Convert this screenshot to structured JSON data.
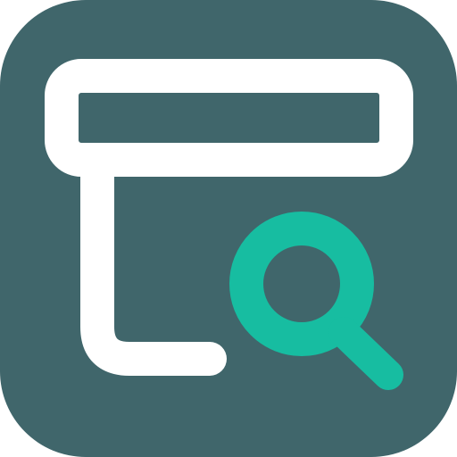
{
  "icon": {
    "name": "archive-search-icon",
    "background_color": "#40666b",
    "primary_stroke_color": "#ffffff",
    "accent_color": "#17bda1",
    "glyphs": [
      "archive-box-icon",
      "magnifier-icon"
    ]
  }
}
